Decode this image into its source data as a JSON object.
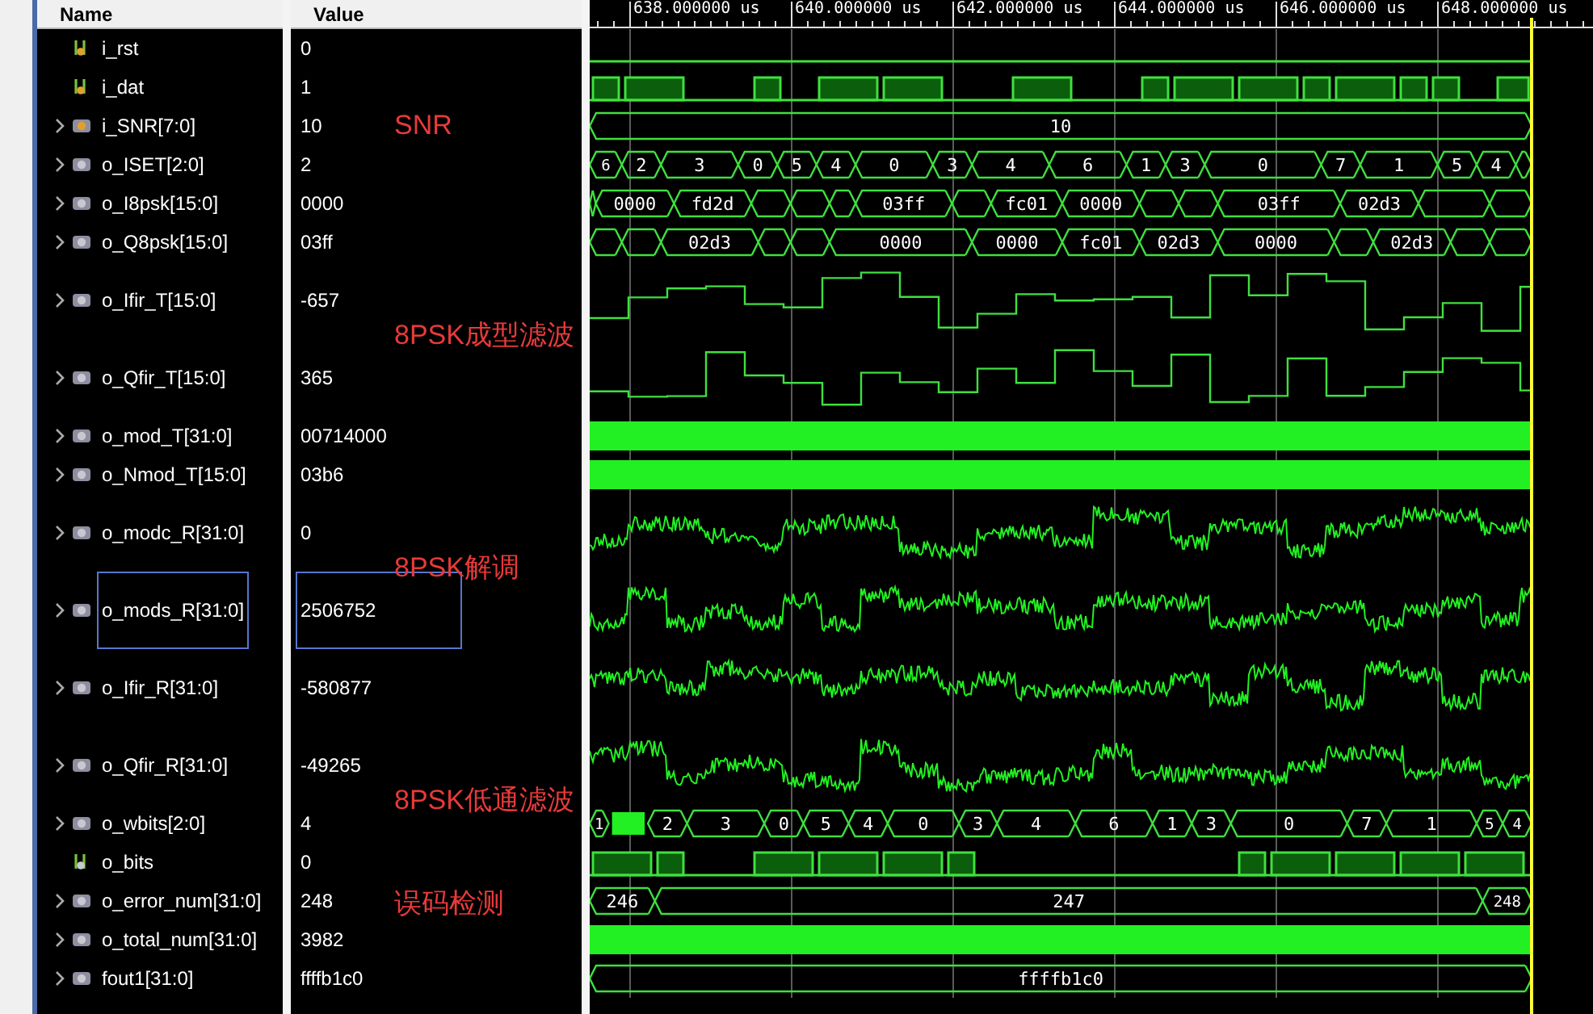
{
  "columns": {
    "name": "Name",
    "value": "Value"
  },
  "time_axis": {
    "labels": [
      "638.000000 us",
      "640.000000 us",
      "642.000000 us",
      "644.000000 us",
      "646.000000 us",
      "648.000000 us"
    ]
  },
  "cursor": {
    "level": 0.939
  },
  "rows": [
    {
      "name": "i_rst",
      "value": "0",
      "kind": "bit",
      "input": true,
      "selected": false,
      "wave": {
        "kind": "flat"
      }
    },
    {
      "name": "i_dat",
      "value": "1",
      "kind": "bit",
      "input": true,
      "selected": false,
      "wave": {
        "kind": "bit"
      }
    },
    {
      "name": "i_SNR[7:0]",
      "value": "10",
      "kind": "bus",
      "input": true,
      "selected": false,
      "annotation": "SNR",
      "wave": {
        "kind": "bus",
        "segments": [
          {
            "value": "10",
            "level": 0.939
          }
        ]
      }
    },
    {
      "name": "o_ISET[2:0]",
      "value": "2",
      "kind": "bus",
      "input": false,
      "selected": false,
      "wave": {
        "kind": "bus",
        "segments": [
          {
            "value": "6",
            "level": 0.032
          },
          {
            "value": "2",
            "level": 0.071
          },
          {
            "value": "3",
            "level": 0.148
          },
          {
            "value": "0",
            "level": 0.187
          },
          {
            "value": "5",
            "level": 0.226
          },
          {
            "value": "4",
            "level": 0.265
          },
          {
            "value": "0",
            "level": 0.342
          },
          {
            "value": "3",
            "level": 0.381
          },
          {
            "value": "4",
            "level": 0.458
          },
          {
            "value": "6",
            "level": 0.535
          },
          {
            "value": "1",
            "level": 0.574
          },
          {
            "value": "3",
            "level": 0.613
          },
          {
            "value": "0",
            "level": 0.729
          },
          {
            "value": "7",
            "level": 0.768
          },
          {
            "value": "1",
            "level": 0.845
          },
          {
            "value": "5",
            "level": 0.884
          },
          {
            "value": "4",
            "level": 0.923
          },
          {
            "level": 0.939
          }
        ]
      }
    },
    {
      "name": "o_I8psk[15:0]",
      "value": "0000",
      "kind": "bus",
      "input": false,
      "selected": false,
      "wave": {
        "kind": "bus",
        "segments": [
          {
            "level": 0.006
          },
          {
            "value": "0000",
            "level": 0.084
          },
          {
            "value": "fd2d",
            "level": 0.161
          },
          {
            "level": 0.2
          },
          {
            "level": 0.239
          },
          {
            "level": 0.265
          },
          {
            "value": "03ff",
            "level": 0.361
          },
          {
            "level": 0.4
          },
          {
            "value": "fc01",
            "level": 0.471
          },
          {
            "value": "0000",
            "level": 0.548
          },
          {
            "level": 0.587
          },
          {
            "level": 0.626
          },
          {
            "value": "03ff",
            "level": 0.748
          },
          {
            "value": "02d3",
            "level": 0.826
          },
          {
            "level": 0.897
          },
          {
            "level": 0.939
          }
        ]
      }
    },
    {
      "name": "o_Q8psk[15:0]",
      "value": "03ff",
      "kind": "bus",
      "input": false,
      "selected": false,
      "wave": {
        "kind": "bus",
        "segments": [
          {
            "level": 0.032
          },
          {
            "level": 0.071
          },
          {
            "value": "02d3",
            "level": 0.168
          },
          {
            "level": 0.2
          },
          {
            "level": 0.239
          },
          {
            "value": "0000",
            "level": 0.381
          },
          {
            "value": "0000",
            "level": 0.471
          },
          {
            "value": "fc01",
            "level": 0.548
          },
          {
            "value": "02d3",
            "level": 0.626
          },
          {
            "value": "0000",
            "level": 0.742
          },
          {
            "level": 0.781
          },
          {
            "value": "02d3",
            "level": 0.858
          },
          {
            "level": 0.897
          },
          {
            "level": 0.939
          }
        ]
      }
    },
    {
      "name": "o_Ifir_T[15:0]",
      "value": "-657",
      "kind": "bus",
      "input": false,
      "selected": false,
      "annotation": "8PSK成型滤波",
      "wave": {
        "kind": "step"
      }
    },
    {
      "name": "o_Qfir_T[15:0]",
      "value": "365",
      "kind": "bus",
      "input": false,
      "selected": false,
      "wave": {
        "kind": "step"
      }
    },
    {
      "name": "o_mod_T[31:0]",
      "value": "00714000",
      "kind": "bus",
      "input": false,
      "selected": false,
      "wave": {
        "kind": "solid",
        "level": 0.939
      }
    },
    {
      "name": "o_Nmod_T[15:0]",
      "value": "03b6",
      "kind": "bus",
      "input": false,
      "selected": false,
      "wave": {
        "kind": "solid",
        "level": 0.939
      }
    },
    {
      "name": "o_modc_R[31:0]",
      "value": "0",
      "kind": "bus",
      "input": false,
      "selected": false,
      "annotation": "8PSK解调",
      "wave": {
        "kind": "noisy"
      }
    },
    {
      "name": "o_mods_R[31:0]",
      "value": "2506752",
      "kind": "bus",
      "input": false,
      "selected": true,
      "wave": {
        "kind": "noisy"
      }
    },
    {
      "name": "o_Ifir_R[31:0]",
      "value": "-580877",
      "kind": "bus",
      "input": false,
      "selected": false,
      "wave": {
        "kind": "noisy"
      }
    },
    {
      "name": "o_Qfir_R[31:0]",
      "value": "-49265",
      "kind": "bus",
      "input": false,
      "selected": false,
      "annotation": "8PSK低通滤波",
      "wave": {
        "kind": "noisy"
      }
    },
    {
      "name": "o_wbits[2:0]",
      "value": "4",
      "kind": "bus",
      "input": false,
      "selected": false,
      "wave": {
        "kind": "bus",
        "segments": [
          {
            "value": "1",
            "level": 0.019
          },
          {
            "kind": "glitch",
            "level": 0.058
          },
          {
            "value": "2",
            "level": 0.097
          },
          {
            "value": "3",
            "level": 0.174
          },
          {
            "value": "0",
            "level": 0.213
          },
          {
            "value": "5",
            "level": 0.258
          },
          {
            "value": "4",
            "level": 0.297
          },
          {
            "value": "0",
            "level": 0.368
          },
          {
            "value": "3",
            "level": 0.406
          },
          {
            "value": "4",
            "level": 0.484
          },
          {
            "value": "6",
            "level": 0.561
          },
          {
            "value": "1",
            "level": 0.6
          },
          {
            "value": "3",
            "level": 0.639
          },
          {
            "value": "0",
            "level": 0.755
          },
          {
            "value": "7",
            "level": 0.794
          },
          {
            "value": "1",
            "level": 0.884
          },
          {
            "value": "5",
            "level": 0.91
          },
          {
            "value": "4",
            "level": 0.939
          }
        ]
      }
    },
    {
      "name": "o_bits",
      "value": "0",
      "kind": "bit",
      "input": false,
      "selected": false,
      "wave": {
        "kind": "bit"
      }
    },
    {
      "name": "o_error_num[31:0]",
      "value": "248",
      "kind": "bus",
      "input": false,
      "selected": false,
      "annotation": "误码检测",
      "wave": {
        "kind": "bus",
        "segments": [
          {
            "value": "246",
            "level": 0.065
          },
          {
            "value": "247",
            "level": 0.89
          },
          {
            "value": "248",
            "level": 0.939
          }
        ]
      }
    },
    {
      "name": "o_total_num[31:0]",
      "value": "3982",
      "kind": "bus",
      "input": false,
      "selected": false,
      "wave": {
        "kind": "solid",
        "level": 0.939
      }
    },
    {
      "name": "fout1[31:0]",
      "value": "ffffb1c0",
      "kind": "bus",
      "input": false,
      "selected": false,
      "wave": {
        "kind": "bus",
        "segments": [
          {
            "value": "ffffb1c0",
            "level": 0.939
          }
        ]
      }
    }
  ]
}
